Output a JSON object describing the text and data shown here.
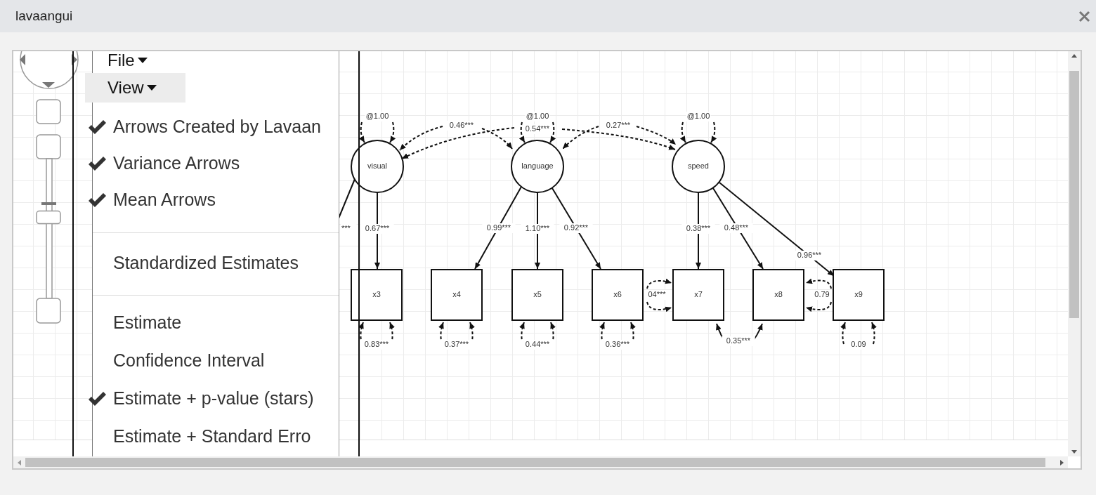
{
  "window": {
    "title": "lavaangui"
  },
  "navigator": {
    "zoom": {
      "level": 0.58
    }
  },
  "menu": {
    "menus": [
      {
        "label": "File",
        "selected": false
      },
      {
        "label": "View",
        "selected": true
      }
    ],
    "sections": [
      [
        {
          "label": "Arrows Created by Lavaan",
          "checked": true
        },
        {
          "label": "Variance Arrows",
          "checked": true
        },
        {
          "label": "Mean Arrows",
          "checked": true
        }
      ],
      [
        {
          "label": "Standardized Estimates",
          "checked": false
        }
      ],
      [
        {
          "label": "Estimate",
          "checked": false
        },
        {
          "label": "Confidence Interval",
          "checked": false
        },
        {
          "label": "Estimate + p-value (stars)",
          "checked": true
        },
        {
          "label": "Estimate + Standard Erro",
          "checked": false
        }
      ]
    ]
  },
  "diagram": {
    "latents": [
      {
        "label": "visual",
        "variance": "@1.00"
      },
      {
        "label": "language",
        "variance": "@1.00"
      },
      {
        "label": "speed",
        "variance": "@1.00"
      }
    ],
    "observed": [
      {
        "label": "x3",
        "variance": "0.83***"
      },
      {
        "label": "x4",
        "variance": "0.37***"
      },
      {
        "label": "x5",
        "variance": "0.44***"
      },
      {
        "label": "x6",
        "variance": "0.36***"
      },
      {
        "label": "x7"
      },
      {
        "label": "x8"
      },
      {
        "label": "x9",
        "variance": "0.09"
      }
    ],
    "loadings": [
      {
        "label": "***"
      },
      {
        "label": "0.67***"
      },
      {
        "label": "0.99***"
      },
      {
        "label": "1.10***"
      },
      {
        "label": "0.92***"
      },
      {
        "label": "0.38***"
      },
      {
        "label": "0.48***"
      },
      {
        "label": "0.96***"
      }
    ],
    "covariances": [
      {
        "label": "0.46***",
        "kind": "dashed"
      },
      {
        "label": "0.54***",
        "kind": "dashed"
      },
      {
        "label": "0.27***",
        "kind": "dashed"
      },
      {
        "label": "04***",
        "kind": "dashed"
      },
      {
        "label": "0.79",
        "kind": "dashed"
      },
      {
        "label": "0.35***",
        "kind": "solid"
      }
    ]
  }
}
